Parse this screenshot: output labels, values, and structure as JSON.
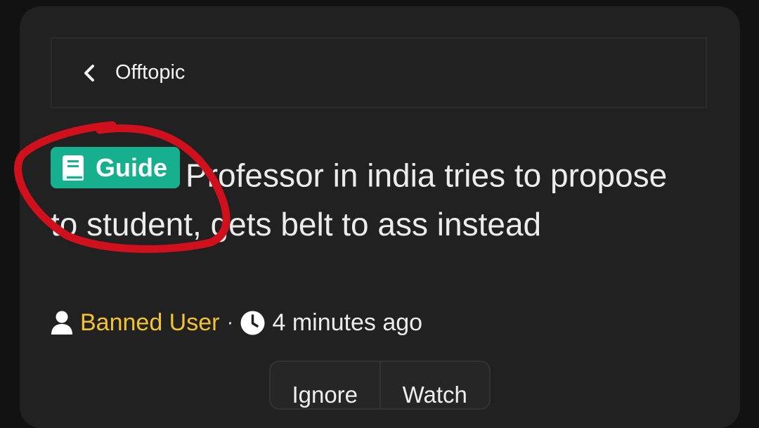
{
  "breadcrumb": {
    "label": "Offtopic"
  },
  "thread": {
    "prefix": "Guide",
    "title": "Professor in india tries to propose to student, gets belt to ass instead"
  },
  "meta": {
    "username": "Banned User",
    "separator": "·",
    "time": "4 minutes ago"
  },
  "actions": {
    "ignore_label": "Ignore",
    "watch_label": "Watch"
  },
  "colors": {
    "prefix_bg": "#17b08f",
    "username": "#f3c233",
    "annotation": "#d0101c",
    "card_bg": "#212121"
  },
  "icons": [
    "chevron-left-icon",
    "book-icon",
    "user-icon",
    "clock-icon"
  ]
}
